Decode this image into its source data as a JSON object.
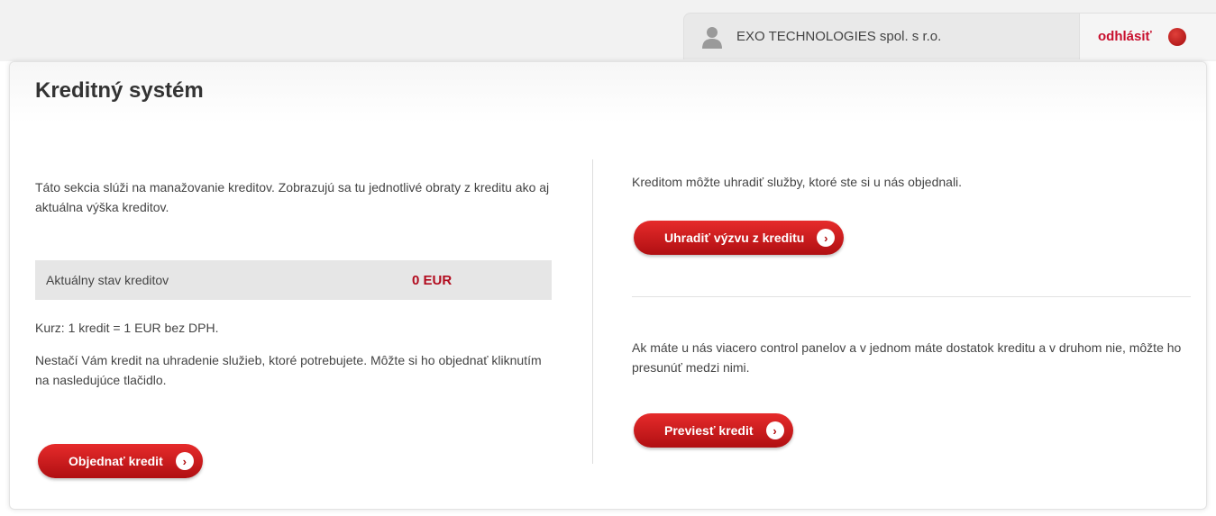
{
  "header": {
    "company_name": "EXO TECHNOLOGIES spol. s r.o.",
    "logout_label": "odhlásiť"
  },
  "page": {
    "title": "Kreditný systém"
  },
  "left": {
    "intro": "Táto sekcia slúži na manažovanie kreditov. Zobrazujú sa tu jednotlivé obraty z kreditu ako aj aktuálna výška kreditov.",
    "credit_label": "Aktuálny stav kreditov",
    "credit_value": "0 EUR",
    "rate": "Kurz: 1 kredit = 1 EUR bez DPH.",
    "order_info": "Nestačí Vám kredit na uhradenie služieb, ktoré potrebujete. Môžte si ho objednať kliknutím na nasledujúce tlačidlo.",
    "order_button": "Objednať kredit"
  },
  "right": {
    "pay_info": "Kreditom môžte uhradiť služby, ktoré ste si u nás objednali.",
    "pay_button": "Uhradiť výzvu z kreditu",
    "transfer_info": "Ak máte u nás viacero control panelov a v jednom máte dostatok kreditu a v druhom nie, môžte ho presunúť medzi nimi.",
    "transfer_button": "Previesť kredit"
  },
  "icons": {
    "user": "user-icon",
    "logout": "logout-icon",
    "arrow": "arrow-right-icon"
  },
  "colors": {
    "accent": "#c8102e",
    "button_top": "#e62b2b",
    "button_bottom": "#b00f12"
  }
}
